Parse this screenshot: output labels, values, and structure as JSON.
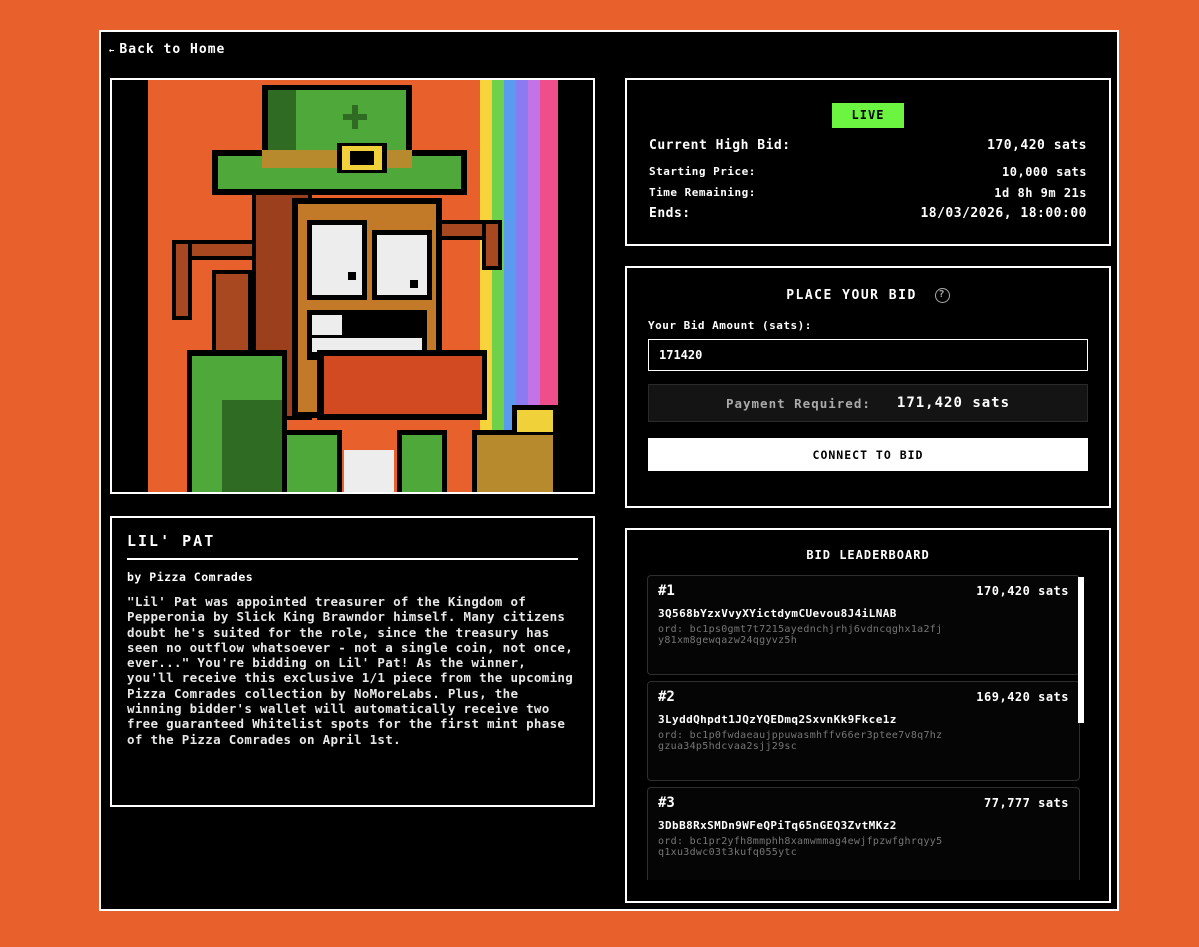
{
  "nav": {
    "back_label": "Back to Home",
    "back_arrow": "←"
  },
  "artwork": {
    "alt": "Lil' Pat pixel art"
  },
  "description": {
    "title": "LIL' PAT",
    "by": "by Pizza Comrades",
    "text": "\"Lil' Pat was appointed treasurer of the Kingdom of Pepperonia by Slick King Brawndor himself. Many citizens doubt he's suited for the role, since the treasury has seen no outflow whatsoever - not a single coin, not once, ever...\" You're bidding on Lil' Pat! As the winner, you'll receive this exclusive 1/1 piece from the upcoming Pizza Comrades collection by NoMoreLabs. Plus, the winning bidder's wallet will automatically receive two free guaranteed Whitelist spots for the first mint phase of the Pizza Comrades on April 1st."
  },
  "status": {
    "badge": "LIVE",
    "current_high_bid_label": "Current High Bid:",
    "current_high_bid_value": "170,420 sats",
    "starting_price_label": "Starting Price:",
    "starting_price_value": "10,000 sats",
    "time_remaining_label": "Time Remaining:",
    "time_remaining_value": "1d 8h 9m 21s",
    "ends_label": "Ends:",
    "ends_value": "18/03/2026, 18:00:00"
  },
  "bid": {
    "title": "PLACE YOUR BID",
    "help": "?",
    "amount_label": "Your Bid Amount (sats):",
    "amount_value": "171420",
    "payment_label": "Payment Required:",
    "payment_value": "171,420 sats",
    "connect_label": "CONNECT TO BID"
  },
  "leaderboard": {
    "title": "BID LEADERBOARD",
    "entries": [
      {
        "rank": "#1",
        "amount": "170,420 sats",
        "address": "3Q568bYzxVvyXYictdymCUevou8J4iLNAB",
        "ord": "ord: bc1ps0gmt7t7215ayednchjrhj6vdncqghx1a2fjy81xm8gewqazw24qgyvz5h"
      },
      {
        "rank": "#2",
        "amount": "169,420 sats",
        "address": "3LyddQhpdt1JQzYQEDmq2SxvnKk9Fkce1z",
        "ord": "ord: bc1p0fwdaeaujppuwasmhffv66er3ptee7v8q7hzgzua34p5hdcvaa2sjj29sc"
      },
      {
        "rank": "#3",
        "amount": "77,777 sats",
        "address": "3DbB8RxSMDn9WFeQPiTq65nGEQ3ZvtMKz2",
        "ord": "ord: bc1pr2yfh8mmphh8xamwmmag4ewjfpzwfghrqyy5q1xu3dwc03t3kufq055ytc"
      }
    ]
  }
}
